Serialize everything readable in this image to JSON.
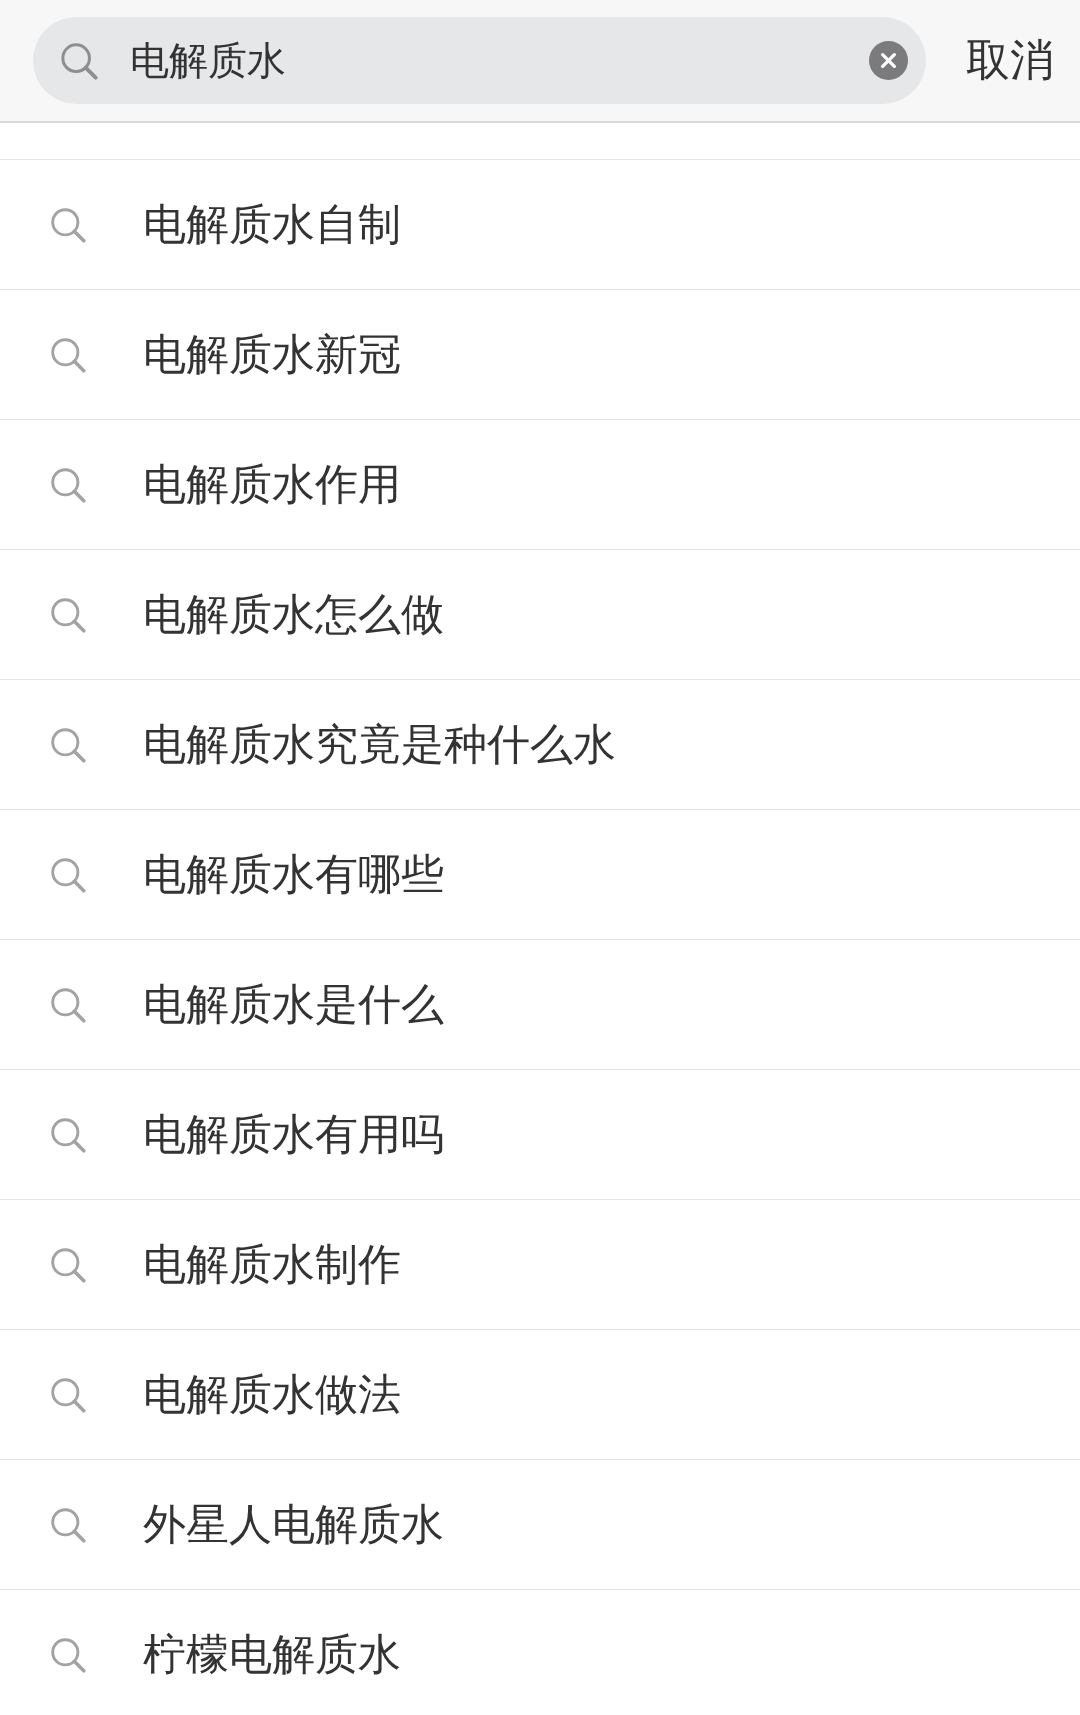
{
  "search": {
    "value": "电解质水",
    "cancel": "取消"
  },
  "suggestions": [
    {
      "text": "电解质水自制"
    },
    {
      "text": "电解质水新冠"
    },
    {
      "text": "电解质水作用"
    },
    {
      "text": "电解质水怎么做"
    },
    {
      "text": "电解质水究竟是种什么水"
    },
    {
      "text": "电解质水有哪些"
    },
    {
      "text": "电解质水是什么"
    },
    {
      "text": "电解质水有用吗"
    },
    {
      "text": "电解质水制作"
    },
    {
      "text": "电解质水做法"
    },
    {
      "text": "外星人电解质水"
    },
    {
      "text": "柠檬电解质水"
    }
  ]
}
